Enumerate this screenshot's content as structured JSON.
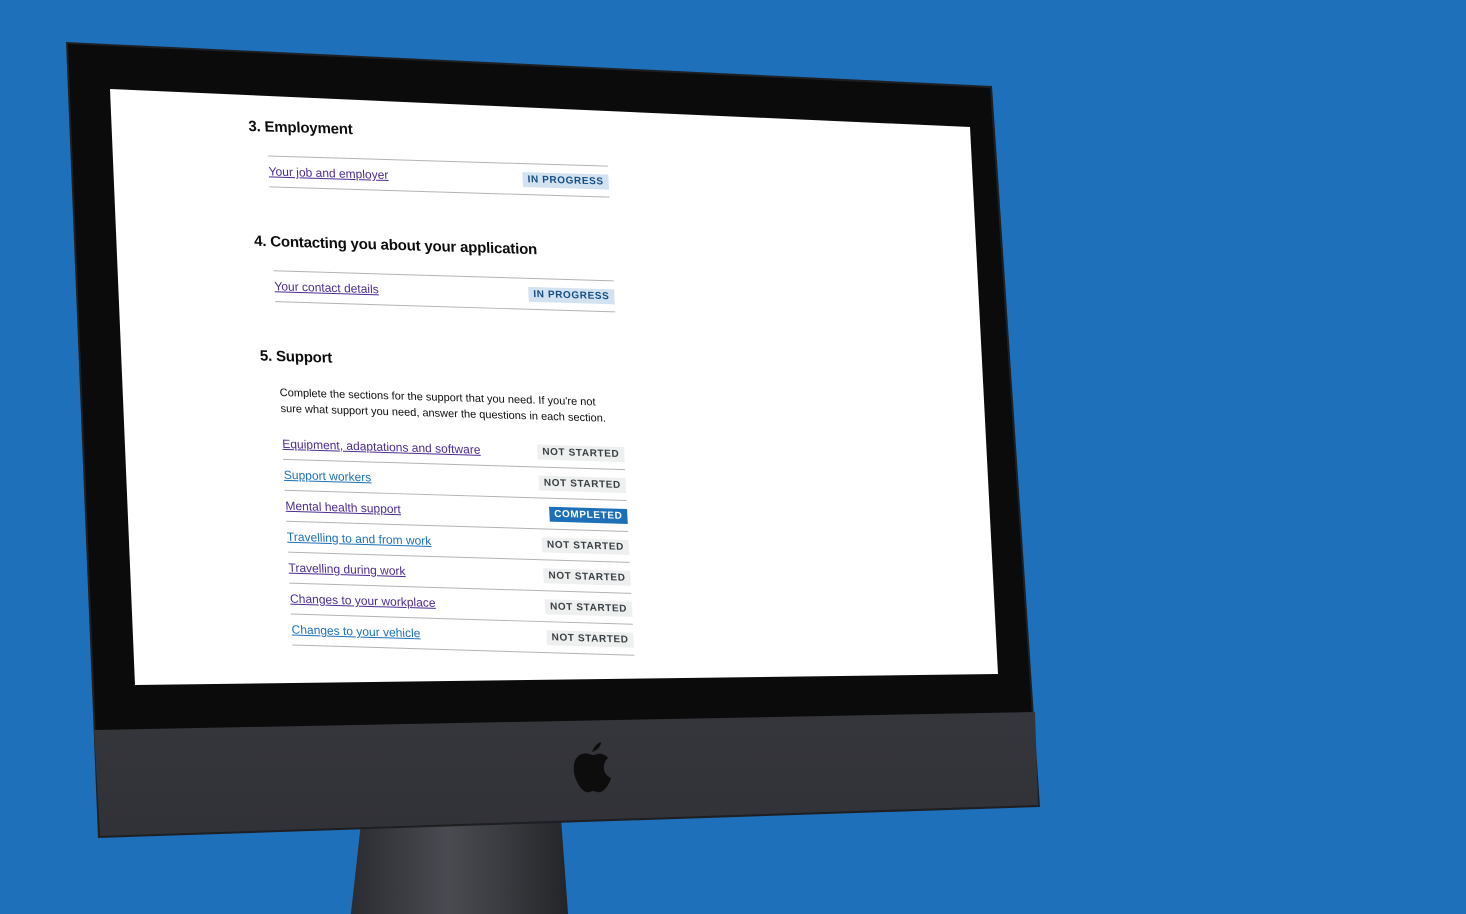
{
  "sections": {
    "employment": {
      "title": "3. Employment",
      "tasks": [
        {
          "label": "Your job and employer",
          "status": "IN PROGRESS"
        }
      ]
    },
    "contacting": {
      "title": "4. Contacting you about your application",
      "tasks": [
        {
          "label": "Your contact details",
          "status": "IN PROGRESS"
        }
      ]
    },
    "support": {
      "title": "5. Support",
      "intro": "Complete the sections for the support that you need. If you're not sure what support you need, answer the questions in each section.",
      "tasks": [
        {
          "label": "Equipment, adaptations and software",
          "status": "NOT STARTED"
        },
        {
          "label": "Support workers",
          "status": "NOT STARTED"
        },
        {
          "label": "Mental health support",
          "status": "COMPLETED"
        },
        {
          "label": "Travelling to and from work",
          "status": "NOT STARTED"
        },
        {
          "label": "Travelling during work",
          "status": "NOT STARTED"
        },
        {
          "label": "Changes to your workplace",
          "status": "NOT STARTED"
        },
        {
          "label": "Changes to your vehicle",
          "status": "NOT STARTED"
        }
      ]
    }
  },
  "colors": {
    "background": "#1f70bb",
    "link_visited": "#4c2c92",
    "link": "#1d70b8",
    "tag_in_progress_bg": "#d2e2f1",
    "tag_not_started_bg": "#eeefef",
    "tag_completed_bg": "#1d70b8"
  },
  "icons": {
    "device_logo": "apple-logo-icon"
  }
}
